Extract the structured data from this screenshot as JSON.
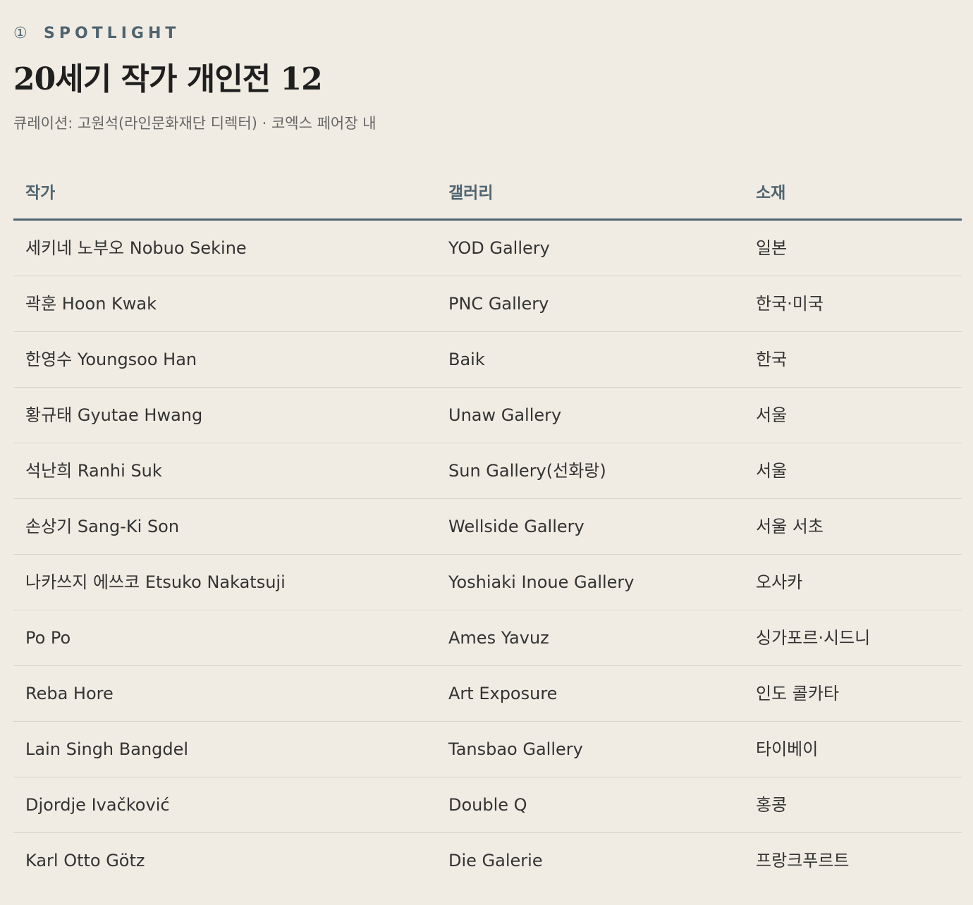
{
  "kicker": {
    "number": "①",
    "label": "SPOTLIGHT"
  },
  "title": "20세기 작가 개인전 12",
  "subtitle": "큐레이션: 고원석(라인문화재단 디렉터) · 코엑스 페어장 내",
  "table": {
    "headers": [
      "작가",
      "갤러리",
      "소재"
    ],
    "rows": [
      [
        "세키네 노부오 Nobuo Sekine",
        "YOD Gallery",
        "일본"
      ],
      [
        "곽훈 Hoon Kwak",
        "PNC Gallery",
        "한국·미국"
      ],
      [
        "한영수 Youngsoo Han",
        "Baik",
        "한국"
      ],
      [
        "황규태 Gyutae Hwang",
        "Unaw Gallery",
        "서울"
      ],
      [
        "석난희 Ranhi Suk",
        "Sun Gallery(선화랑)",
        "서울"
      ],
      [
        "손상기 Sang-Ki Son",
        "Wellside Gallery",
        "서울 서초"
      ],
      [
        "나카쓰지 에쓰코 Etsuko Nakatsuji",
        "Yoshiaki Inoue Gallery",
        "오사카"
      ],
      [
        "Po Po",
        "Ames Yavuz",
        "싱가포르·시드니"
      ],
      [
        "Reba Hore",
        "Art Exposure",
        "인도 콜카타"
      ],
      [
        "Lain Singh Bangdel",
        "Tansbao Gallery",
        "타이베이"
      ],
      [
        "Djordje Ivačković",
        "Double Q",
        "홍콩"
      ],
      [
        "Karl Otto Götz",
        "Die Galerie",
        "프랑크푸르트"
      ]
    ]
  }
}
